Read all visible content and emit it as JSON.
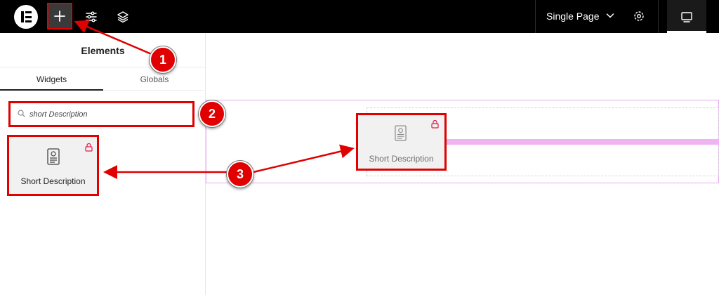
{
  "topbar": {
    "page_label": "Single Page",
    "icons": [
      "elementor-logo-icon",
      "plus-icon",
      "sliders-icon",
      "layers-icon",
      "chevron-down-icon",
      "gear-icon",
      "desktop-icon"
    ]
  },
  "panel": {
    "title": "Elements",
    "tabs": [
      {
        "label": "Widgets",
        "active": true
      },
      {
        "label": "Globals",
        "active": false
      }
    ],
    "search": {
      "value": "short Description",
      "placeholder": "Search Widget..."
    },
    "widget": {
      "label": "Short Description",
      "icon": "document-icon",
      "badge_icon": "lock-icon"
    }
  },
  "canvas": {
    "drag_widget_label": "Short Description"
  },
  "annotations": {
    "steps": [
      "1",
      "2",
      "3"
    ],
    "color": "#e00000"
  }
}
